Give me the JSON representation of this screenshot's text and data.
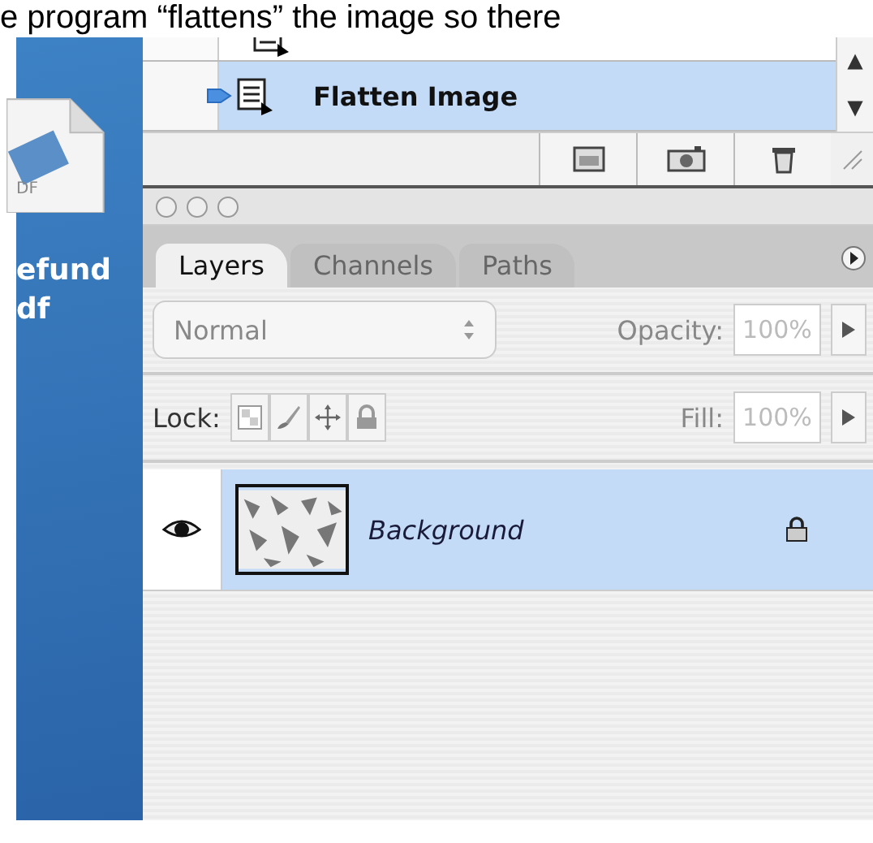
{
  "caption": "e program “flattens” the image so there",
  "desktop": {
    "file_badge": "DF",
    "file_label": [
      "efund",
      "df"
    ]
  },
  "history": {
    "items": [
      {
        "selected": false,
        "current": false
      },
      {
        "label": "Flatten Image",
        "selected": true,
        "current": true
      }
    ]
  },
  "layers_panel": {
    "tabs": [
      {
        "label": "Layers",
        "selected": true
      },
      {
        "label": "Channels",
        "selected": false
      },
      {
        "label": "Paths",
        "selected": false
      }
    ],
    "blend_mode": {
      "value": "Normal",
      "disabled": true
    },
    "opacity": {
      "label": "Opacity:",
      "value": "100%",
      "disabled": true
    },
    "lock_label": "Lock:",
    "fill": {
      "label": "Fill:",
      "value": "100%",
      "disabled": true
    },
    "layers": [
      {
        "name": "Background",
        "visible": true,
        "locked": true,
        "selected": true
      }
    ]
  }
}
